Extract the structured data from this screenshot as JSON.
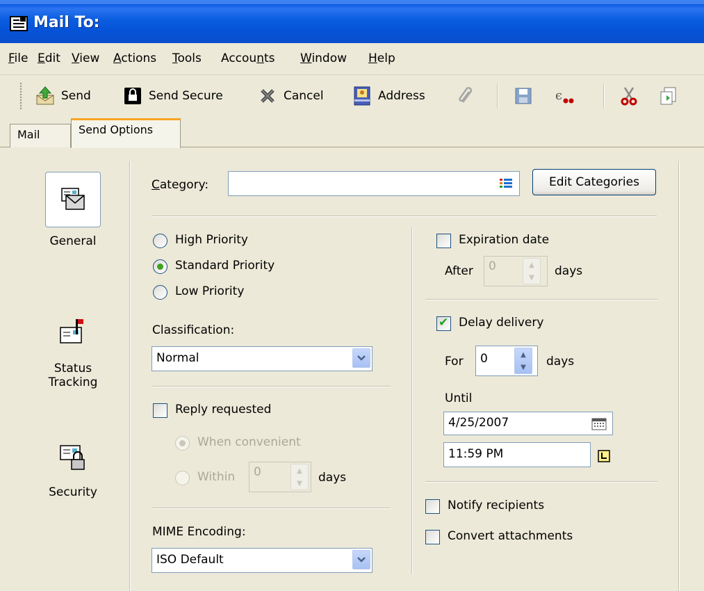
{
  "window": {
    "title": "Mail To:"
  },
  "menu": [
    "File",
    "Edit",
    "View",
    "Actions",
    "Tools",
    "Accounts",
    "Window",
    "Help"
  ],
  "toolbar": {
    "send": "Send",
    "send_secure": "Send Secure",
    "cancel": "Cancel",
    "address": "Address"
  },
  "tabs": {
    "mail": "Mail",
    "send_options": "Send Options"
  },
  "sidebar": {
    "general": "General",
    "status_tracking_1": "Status",
    "status_tracking_2": "Tracking",
    "security": "Security"
  },
  "category": {
    "label": "Category:",
    "value": "",
    "edit_button": "Edit Categories"
  },
  "priority": {
    "high": "High Priority",
    "standard": "Standard Priority",
    "low": "Low Priority",
    "selected": "standard"
  },
  "classification": {
    "label": "Classification:",
    "value": "Normal"
  },
  "reply": {
    "label": "Reply requested",
    "checked": false,
    "when_convenient": "When convenient",
    "within": "Within",
    "within_value": "0",
    "days": "days"
  },
  "mime": {
    "label": "MIME Encoding:",
    "value": "ISO Default"
  },
  "expiration": {
    "label": "Expiration date",
    "checked": false,
    "after": "After",
    "after_value": "0",
    "days": "days"
  },
  "delay": {
    "label": "Delay delivery",
    "checked": true,
    "for": "For",
    "for_value": "0",
    "days": "days",
    "until": "Until",
    "date": "4/25/2007",
    "time": "11:59 PM"
  },
  "notify": {
    "label": "Notify recipients",
    "checked": false
  },
  "convert": {
    "label": "Convert attachments",
    "checked": false
  }
}
